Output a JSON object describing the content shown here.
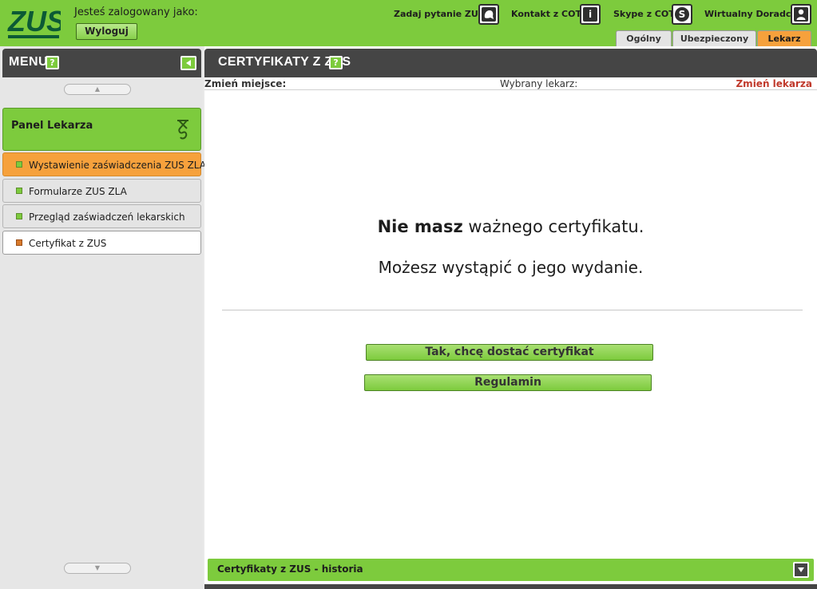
{
  "brand": {
    "logo_text": "ZUS",
    "color": "#7dcb3d",
    "accent": "#f6a13c"
  },
  "header": {
    "logged_in_label": "Jesteś zalogowany jako:",
    "logout_label": "Wyloguj",
    "links": [
      {
        "label": "Zadaj pytanie ZUS",
        "icon": "chat-icon"
      },
      {
        "label": "Kontakt z COT",
        "icon": "info-icon"
      },
      {
        "label": "Skype z COT",
        "icon": "skype-icon"
      },
      {
        "label": "Wirtualny Doradca",
        "icon": "user-icon"
      }
    ],
    "tabs": [
      {
        "label": "Ogólny"
      },
      {
        "label": "Ubezpieczony"
      },
      {
        "label": "Lekarz",
        "active": true
      }
    ]
  },
  "sidebar": {
    "title": "MENU",
    "help_label": "?",
    "panel_title": "Panel Lekarza",
    "items": [
      {
        "label": "Wystawienie zaświadczenia ZUS ZLA"
      },
      {
        "label": "Formularze ZUS ZLA"
      },
      {
        "label": "Przegląd zaświadczeń lekarskich"
      },
      {
        "label": "Certyfikat z ZUS"
      }
    ]
  },
  "main": {
    "title": "CERTYFIKATY Z ZUS",
    "help_label": "?",
    "change_place": "Zmień miejsce:",
    "chosen_doctor": "Wybrany lekarz:",
    "change_doctor": "Zmień lekarza",
    "message_bold": "Nie masz",
    "message_rest": " ważnego certyfikatu.",
    "message_line2": "Możesz wystąpić o jego wydanie.",
    "get_cert_button": "Tak, chcę dostać certyfikat",
    "terms_button": "Regulamin",
    "history_title": "Certyfikaty z ZUS - historia"
  }
}
